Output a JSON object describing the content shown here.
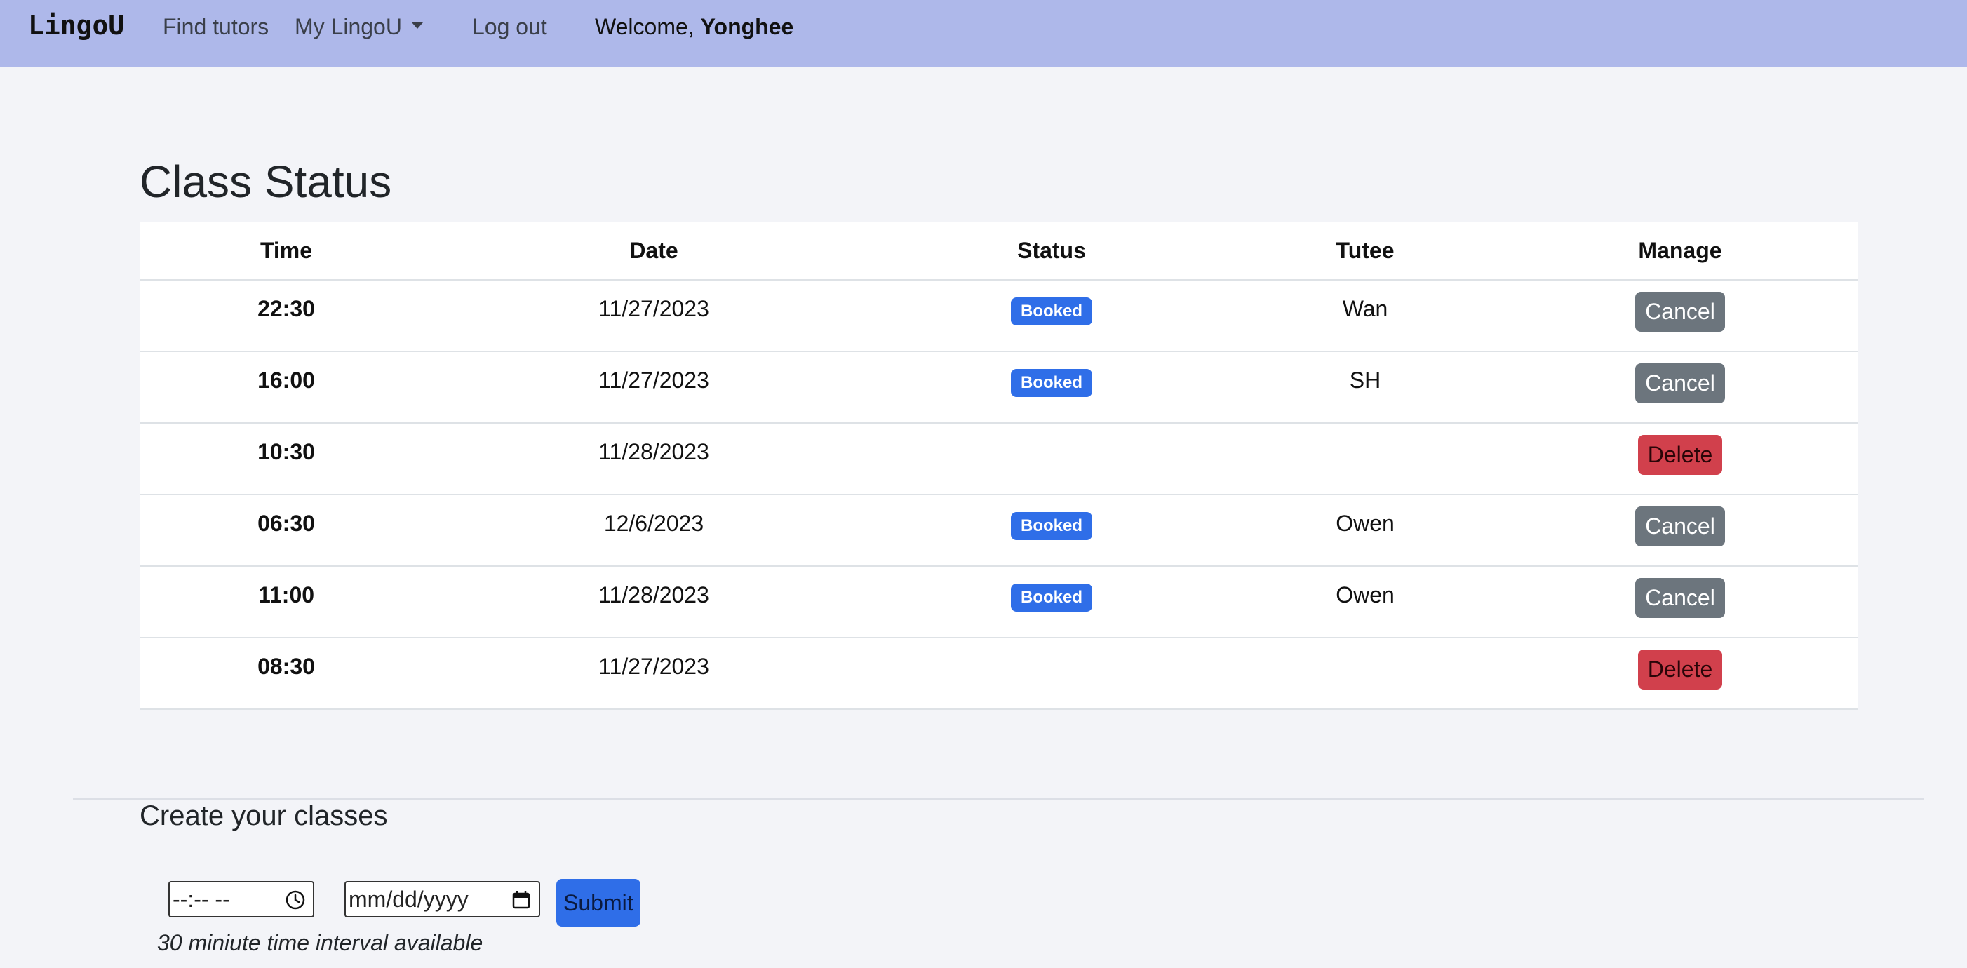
{
  "nav": {
    "brand": "LingoU",
    "find_tutors": "Find tutors",
    "my_lingou": "My LingoU",
    "log_out": "Log out",
    "welcome_prefix": "Welcome,",
    "username": "Yonghee"
  },
  "colors": {
    "navbar": "#aeb8ea",
    "page_bg": "#f3f4f8",
    "badge_booked": "#2f6ee8",
    "btn_cancel": "#6c757d",
    "btn_delete": "#d1404c",
    "btn_submit": "#2f6ee8"
  },
  "page_title": "Class Status",
  "table": {
    "headers": {
      "time": "Time",
      "date": "Date",
      "status": "Status",
      "tutee": "Tutee",
      "manage": "Manage"
    },
    "rows": [
      {
        "time": "22:30",
        "date": "11/27/2023",
        "status": "Booked",
        "tutee": "Wan",
        "action": "Cancel"
      },
      {
        "time": "16:00",
        "date": "11/27/2023",
        "status": "Booked",
        "tutee": "SH",
        "action": "Cancel"
      },
      {
        "time": "10:30",
        "date": "11/28/2023",
        "status": "",
        "tutee": "",
        "action": "Delete"
      },
      {
        "time": "06:30",
        "date": "12/6/2023",
        "status": "Booked",
        "tutee": "Owen",
        "action": "Cancel"
      },
      {
        "time": "11:00",
        "date": "11/28/2023",
        "status": "Booked",
        "tutee": "Owen",
        "action": "Cancel"
      },
      {
        "time": "08:30",
        "date": "11/27/2023",
        "status": "",
        "tutee": "",
        "action": "Delete"
      }
    ]
  },
  "create": {
    "title": "Create your classes",
    "time_placeholder": "--:-- --",
    "date_placeholder": "mm/dd/yyyy",
    "submit_label": "Submit",
    "hint": "30 miniute time interval available",
    "time_icon": "clock-icon",
    "date_icon": "calendar-icon"
  }
}
